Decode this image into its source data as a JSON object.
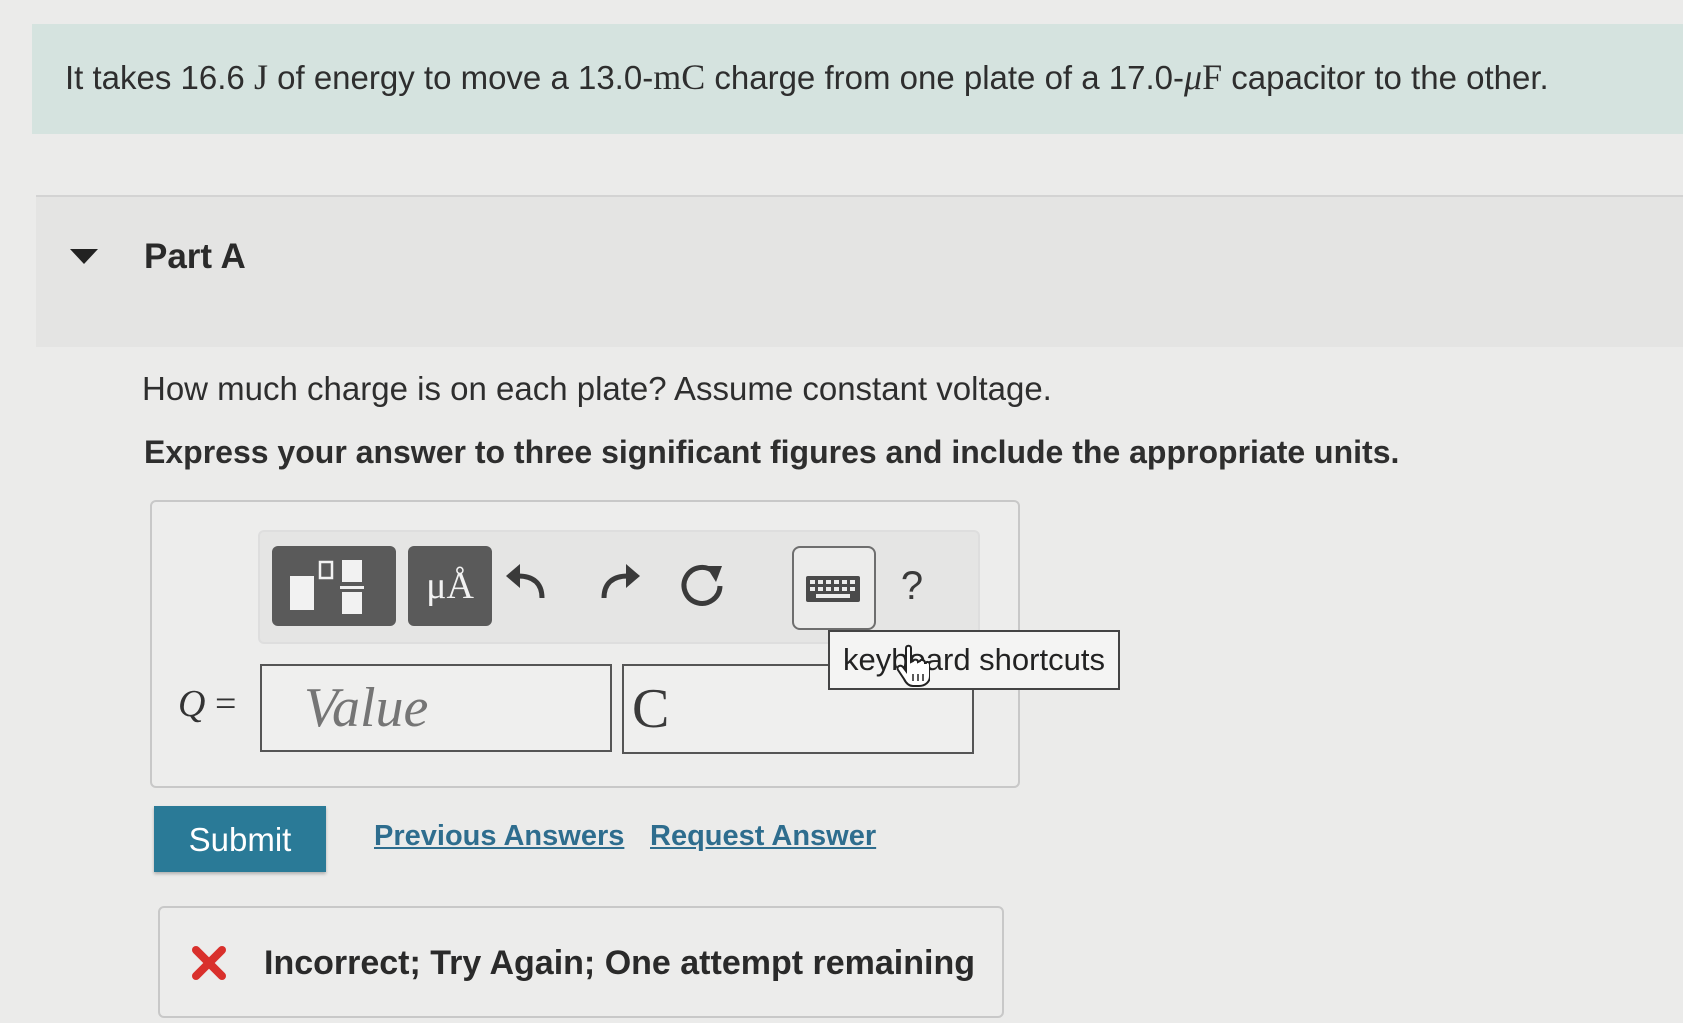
{
  "problem": {
    "text_1": "It takes 16.6 ",
    "energy_unit": "J",
    "text_2": " of energy to move a 13.0-",
    "charge_unit": "mC",
    "text_3": " charge from one plate of a 17.0-",
    "mu": "μ",
    "capacitance_unit": "F",
    "text_4": " capacitor to the other."
  },
  "part": {
    "title": "Part A",
    "question": "How much charge is on each plate? Assume constant voltage.",
    "instruction": "Express your answer to three significant figures and include the appropriate units."
  },
  "toolbar": {
    "units_label": "μÅ",
    "help_label": "?",
    "tooltip": "keyboard shortcuts"
  },
  "answer": {
    "variable": "Q",
    "equals": "=",
    "value_placeholder": "Value",
    "unit_value": "C"
  },
  "actions": {
    "submit_label": "Submit",
    "previous_answers_label": "Previous Answers",
    "request_answer_label": "Request Answer"
  },
  "feedback": {
    "message": "Incorrect; Try Again; One attempt remaining"
  },
  "colors": {
    "banner": "#d5e3df",
    "submit": "#2a7a97",
    "link": "#2e6d8e",
    "error": "#d9302c"
  }
}
